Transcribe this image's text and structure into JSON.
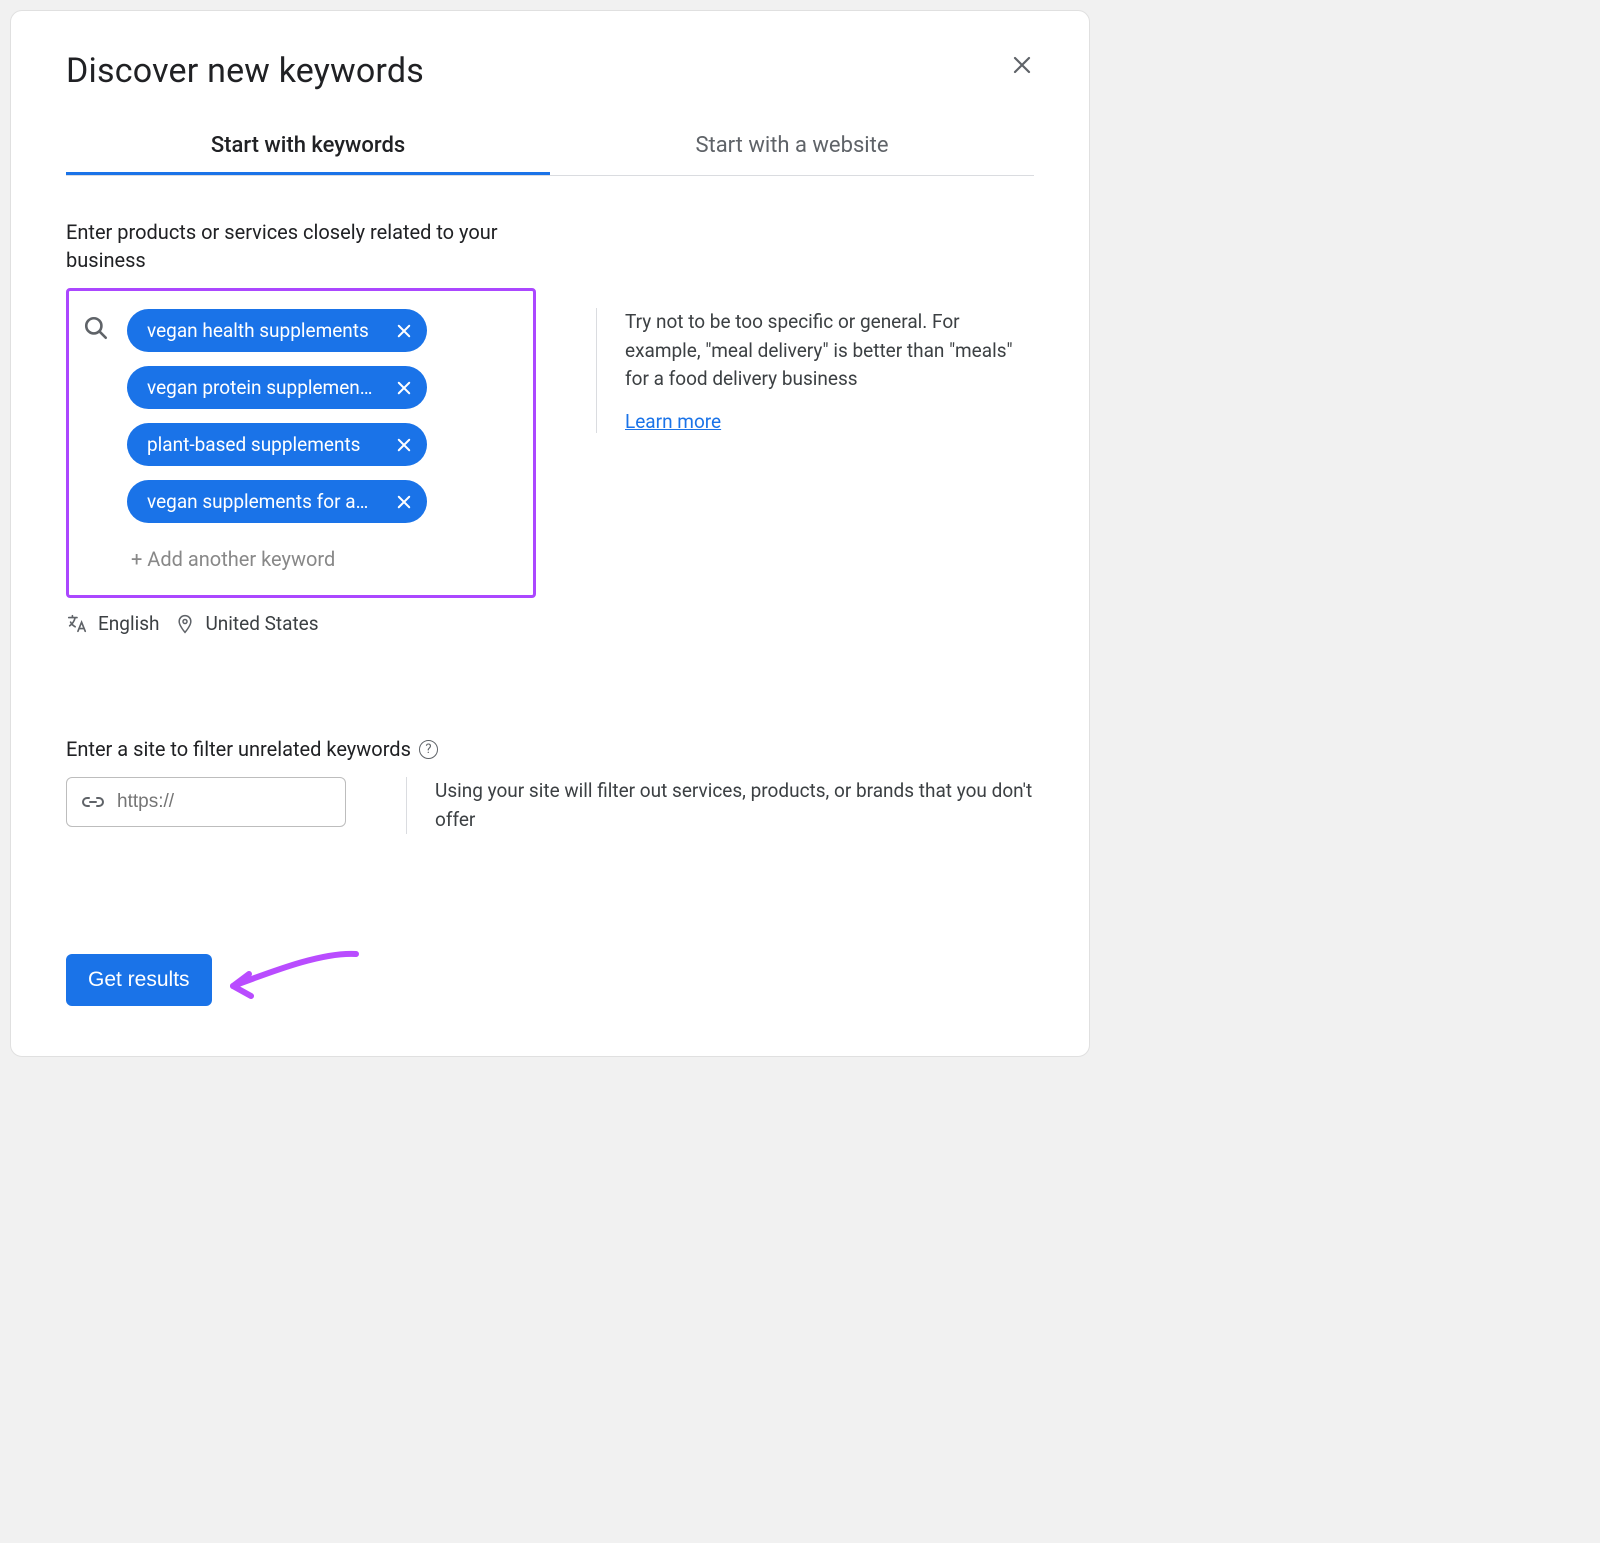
{
  "header": {
    "title": "Discover new keywords"
  },
  "tabs": {
    "keywords": "Start with keywords",
    "website": "Start with a website"
  },
  "keywords_section": {
    "label": "Enter products or services closely related to your business",
    "chips": [
      "vegan health supplements",
      "vegan protein supplemen…",
      "plant-based supplements",
      "vegan supplements for a…"
    ],
    "add_another": "+ Add another keyword",
    "language": "English",
    "location": "United States",
    "tip": "Try not to be too specific or general. For example, \"meal delivery\" is better than \"meals\" for a food delivery business",
    "learn_more": "Learn more"
  },
  "site_section": {
    "label": "Enter a site to filter unrelated keywords",
    "placeholder": "https://",
    "tip": "Using your site will filter out services, products, or brands that you don't offer"
  },
  "actions": {
    "get_results": "Get results"
  }
}
